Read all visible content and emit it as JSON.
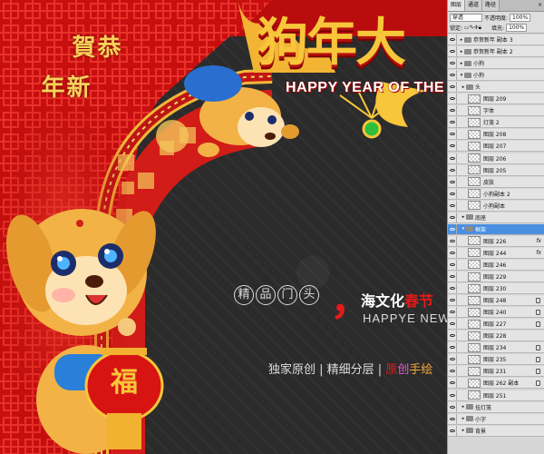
{
  "canvas": {
    "headline": "狗年大",
    "subline": "HAPPY YEAR OF THE D",
    "greeting_top": "恭賀",
    "greeting_bottom": "新年",
    "lantern_char": "福",
    "promo_circles": [
      "精",
      "品",
      "门",
      "头"
    ],
    "promo_comma": "，",
    "promo_main_a": "海文化",
    "promo_main_b": "春",
    "promo_main_c": "节",
    "promo_en": "HAPPYE NEW Y",
    "promo_sub_a": "独家原创 | 精细分层 | ",
    "promo_sub_b": "原",
    "promo_sub_c": "创",
    "promo_sub_d": "手绘",
    "colors": {
      "red": "#d81412",
      "gold": "#f7c63a",
      "dark_bg": "#2b2b2b"
    }
  },
  "panel": {
    "tabs": [
      "图层",
      "通道",
      "路径"
    ],
    "close_glyph": "×",
    "blend_mode": "穿透",
    "opacity_label": "不透明度:",
    "opacity_value": "100%",
    "lock_label": "锁定:",
    "fill_label": "填充:",
    "fill_value": "100%",
    "layers": [
      {
        "name": "恭贺新年 副本 3",
        "kind": "group",
        "eye": true
      },
      {
        "name": "恭贺新年 副本 2",
        "kind": "group",
        "eye": true
      },
      {
        "name": "小狗",
        "kind": "group",
        "eye": true
      },
      {
        "name": "小狗",
        "kind": "group-open",
        "eye": true
      },
      {
        "name": "头",
        "kind": "group",
        "eye": true
      },
      {
        "name": "图层 209",
        "kind": "layer",
        "eye": true
      },
      {
        "name": "字体",
        "kind": "layer",
        "eye": true
      },
      {
        "name": "灯笼 2",
        "kind": "layer",
        "eye": true
      },
      {
        "name": "图层 208",
        "kind": "layer",
        "eye": true
      },
      {
        "name": "图层 207",
        "kind": "layer",
        "eye": true
      },
      {
        "name": "图层 206",
        "kind": "layer",
        "eye": true
      },
      {
        "name": "图层 205",
        "kind": "layer",
        "eye": true
      },
      {
        "name": "皮肤",
        "kind": "layer",
        "eye": true
      },
      {
        "name": "小狗副本 2",
        "kind": "layer",
        "eye": true
      },
      {
        "name": "小狗副本",
        "kind": "layer",
        "eye": true
      },
      {
        "name": "底座",
        "kind": "group",
        "eye": true
      },
      {
        "name": "框架",
        "kind": "group-open",
        "eye": true,
        "selected": true
      },
      {
        "name": "图层 226",
        "kind": "layer",
        "eye": true,
        "fx": "fx"
      },
      {
        "name": "图层 244",
        "kind": "layer",
        "eye": true,
        "fx": "fx"
      },
      {
        "name": "图层 246",
        "kind": "layer",
        "eye": true
      },
      {
        "name": "图层 229",
        "kind": "layer",
        "eye": true
      },
      {
        "name": "图层 230",
        "kind": "layer",
        "eye": true
      },
      {
        "name": "图层 248",
        "kind": "layer",
        "eye": true,
        "lock": true
      },
      {
        "name": "图层 240",
        "kind": "layer",
        "eye": true,
        "lock": true
      },
      {
        "name": "图层 227",
        "kind": "layer",
        "eye": true,
        "lock": true
      },
      {
        "name": "图层 228",
        "kind": "layer",
        "eye": true
      },
      {
        "name": "图层 234",
        "kind": "layer",
        "eye": true,
        "lock": true
      },
      {
        "name": "图层 235",
        "kind": "layer",
        "eye": true,
        "lock": true
      },
      {
        "name": "图层 231",
        "kind": "layer",
        "eye": true,
        "lock": true
      },
      {
        "name": "图层 262 副本",
        "kind": "layer",
        "eye": true,
        "lock": true
      },
      {
        "name": "图层 251",
        "kind": "layer",
        "eye": true
      },
      {
        "name": "挂灯笼",
        "kind": "group",
        "eye": true
      },
      {
        "name": "小字",
        "kind": "group",
        "eye": true
      },
      {
        "name": "背景",
        "kind": "group",
        "eye": true
      }
    ]
  }
}
